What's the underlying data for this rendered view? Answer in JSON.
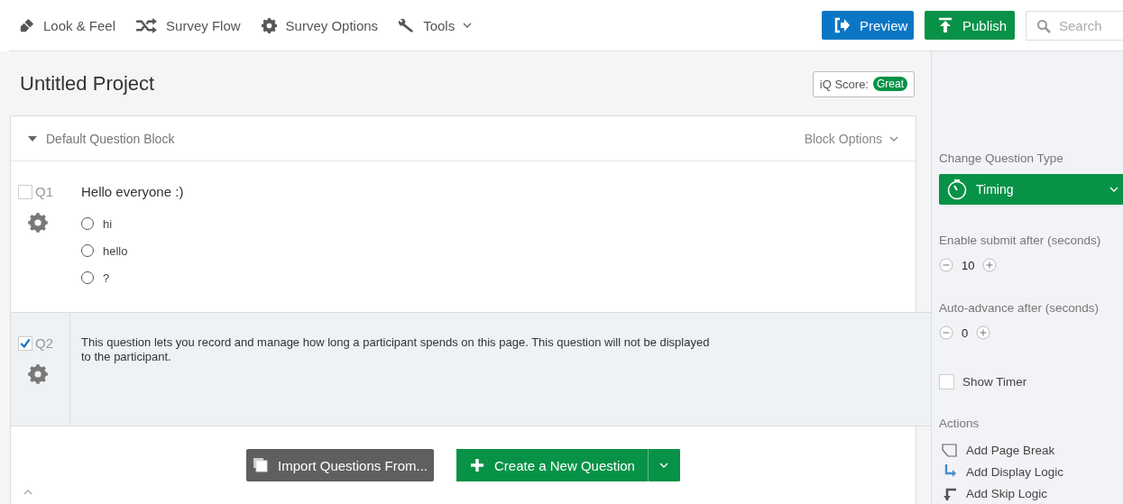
{
  "toolbar": {
    "items": [
      {
        "label": "Look & Feel",
        "kind": "brush",
        "has_menu": false
      },
      {
        "label": "Survey Flow",
        "kind": "flow",
        "has_menu": false
      },
      {
        "label": "Survey Options",
        "kind": "gear",
        "has_menu": false
      },
      {
        "label": "Tools",
        "kind": "wrench",
        "has_menu": true
      }
    ],
    "preview": "Preview",
    "publish": "Publish",
    "search": {
      "placeholder": "Search"
    }
  },
  "project": {
    "title": "Untitled Project",
    "iq_label": "iQ Score:",
    "iq_value": "Great"
  },
  "block": {
    "title": "Default Question Block",
    "expanded": true,
    "options": "Block Options"
  },
  "questions": [
    {
      "number": "Q1",
      "checked": false,
      "selected": false,
      "text": "Hello everyone :)",
      "choices": [
        "hi",
        "hello",
        "?"
      ]
    },
    {
      "number": "Q2",
      "checked": true,
      "selected": true,
      "text": "This question lets you record and manage how long a participant spends on this page. This question will not be displayed to the participant."
    }
  ],
  "bottom": {
    "import": "Import Questions From...",
    "create": "Create a New Question"
  },
  "panel": {
    "change_type": "Change Question Type",
    "type": "Timing",
    "fields": [
      {
        "label": "Enable submit after (seconds)",
        "value": "10"
      },
      {
        "label": "Auto-advance after (seconds)",
        "value": "0"
      }
    ],
    "show_timer": {
      "label": "Show Timer",
      "checked": false
    },
    "actions_title": "Actions",
    "actions": [
      {
        "label": "Add Page Break",
        "kind": "page-break"
      },
      {
        "label": "Add Display Logic",
        "kind": "display-logic"
      },
      {
        "label": "Add Skip Logic",
        "kind": "skip-logic"
      }
    ]
  }
}
